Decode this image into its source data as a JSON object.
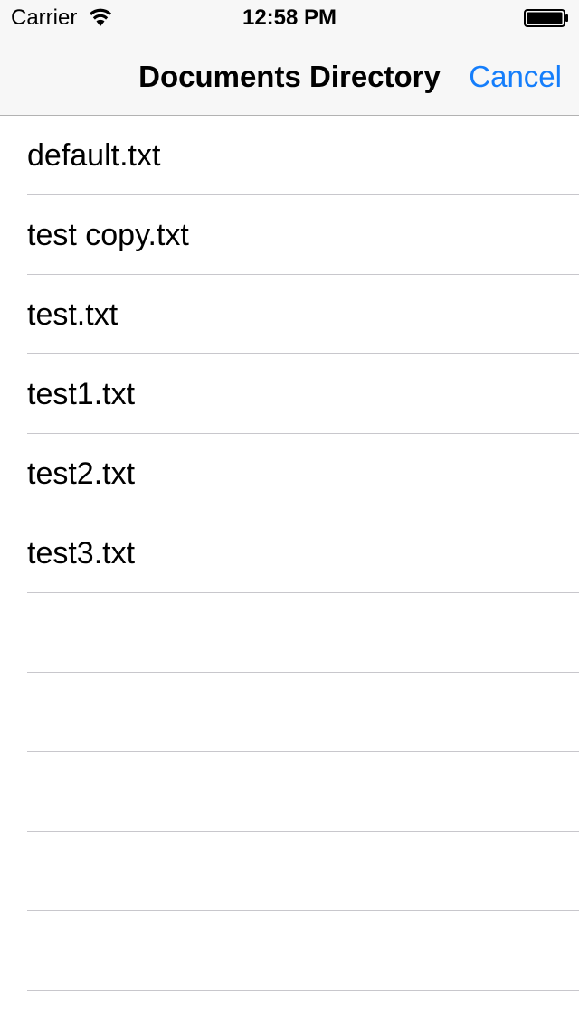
{
  "status_bar": {
    "carrier": "Carrier",
    "time": "12:58 PM",
    "wifi_icon": "wifi-icon",
    "battery_icon": "battery-icon"
  },
  "nav_bar": {
    "title": "Documents Directory",
    "cancel_label": "Cancel",
    "accent_color": "#157efb"
  },
  "files": [
    {
      "name": "default.txt"
    },
    {
      "name": "test copy.txt"
    },
    {
      "name": "test.txt"
    },
    {
      "name": "test1.txt"
    },
    {
      "name": "test2.txt"
    },
    {
      "name": "test3.txt"
    }
  ]
}
